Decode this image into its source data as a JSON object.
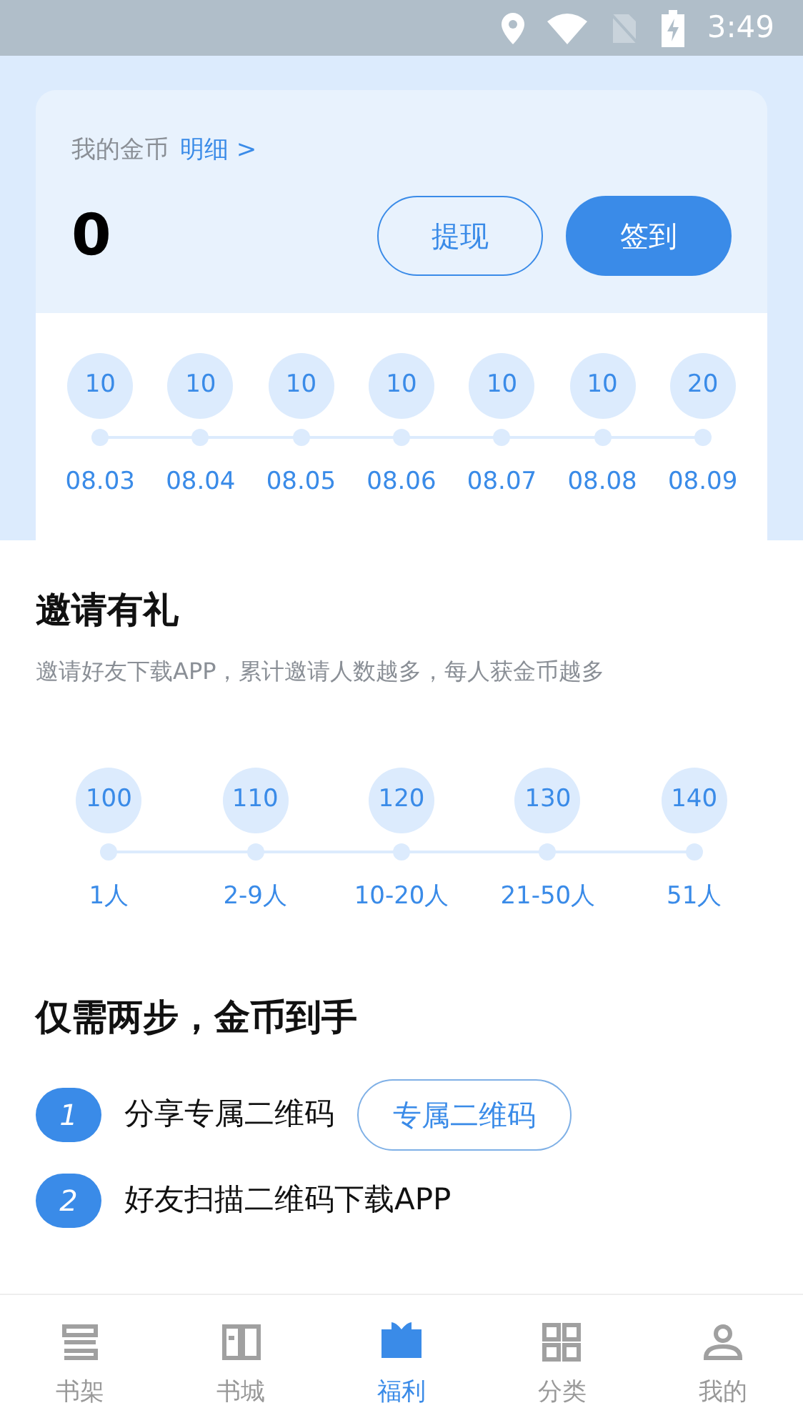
{
  "status_bar": {
    "time": "3:49"
  },
  "coins": {
    "label": "我的金币",
    "detail_link": "明细 >",
    "amount": "0",
    "buttons": [
      {
        "label": "提现",
        "kind": "outline"
      },
      {
        "label": "签到",
        "kind": "solid"
      }
    ]
  },
  "checkin_days": [
    {
      "coins": "10",
      "date": "08.03"
    },
    {
      "coins": "10",
      "date": "08.04"
    },
    {
      "coins": "10",
      "date": "08.05"
    },
    {
      "coins": "10",
      "date": "08.06"
    },
    {
      "coins": "10",
      "date": "08.07"
    },
    {
      "coins": "10",
      "date": "08.08"
    },
    {
      "coins": "20",
      "date": "08.09"
    }
  ],
  "invite": {
    "title": "邀请有礼",
    "subtitle": "邀请好友下载APP，累计邀请人数越多，每人获金币越多",
    "tiers": [
      {
        "coins": "100",
        "people": "1人"
      },
      {
        "coins": "110",
        "people": "2-9人"
      },
      {
        "coins": "120",
        "people": "10-20人"
      },
      {
        "coins": "130",
        "people": "21-50人"
      },
      {
        "coins": "140",
        "people": "51人"
      }
    ]
  },
  "steps": {
    "title": "仅需两步，金币到手",
    "items": [
      {
        "number": "1",
        "text": "分享专属二维码",
        "button": "专属二维码"
      },
      {
        "number": "2",
        "text": "好友扫描二维码下载APP"
      }
    ]
  },
  "tab_bar": [
    {
      "label": "书架",
      "selected": false
    },
    {
      "label": "书城",
      "selected": false
    },
    {
      "label": "福利",
      "selected": true
    },
    {
      "label": "分类",
      "selected": false
    },
    {
      "label": "我的",
      "selected": false
    }
  ]
}
